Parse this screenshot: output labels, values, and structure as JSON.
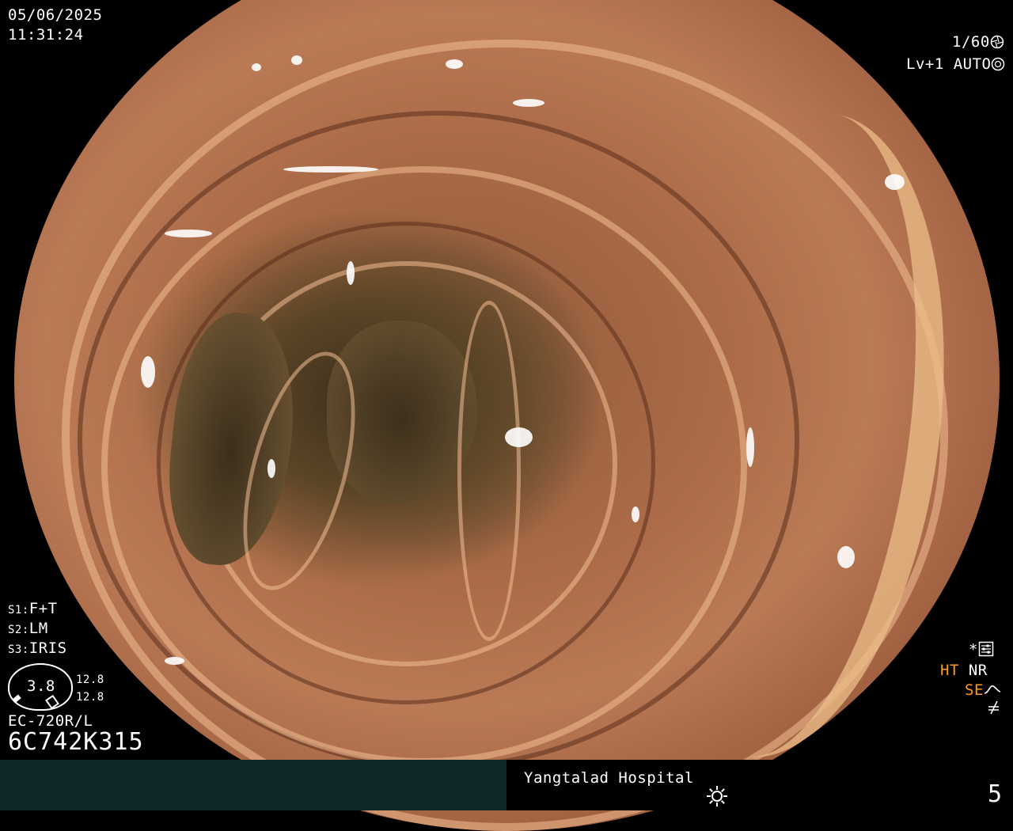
{
  "header": {
    "date": "05/06/2025",
    "time": "11:31:24",
    "shutter": "1/60",
    "level": "Lv+1",
    "exposure": "AUTO"
  },
  "settings": {
    "s1_key": "S1:",
    "s1_value": "F+T",
    "s2_key": "S2:",
    "s2_value": "LM",
    "s3_key": "S3:",
    "s3_value": "IRIS"
  },
  "zoom": {
    "value": "3.8",
    "top_value": "12.8",
    "bottom_value": "12.8"
  },
  "scope_info": {
    "model": "EC-720R/L",
    "serial": "6C742K315"
  },
  "status": {
    "star": "*",
    "ht": "HT",
    "nr": "NR",
    "se": "SE"
  },
  "footer": {
    "hospital": "Yangtalad Hospital",
    "number": "5"
  },
  "icons": {
    "shutter": "aperture-icon",
    "exposure": "iris-icon",
    "settings": "settings-panel-icon",
    "se": "enhancement-curve-icon",
    "lightning": "flash-off-icon",
    "light": "light-icon"
  },
  "colors": {
    "accent_orange": "#ff9a1a",
    "footer_left_bg": "#11282a"
  }
}
